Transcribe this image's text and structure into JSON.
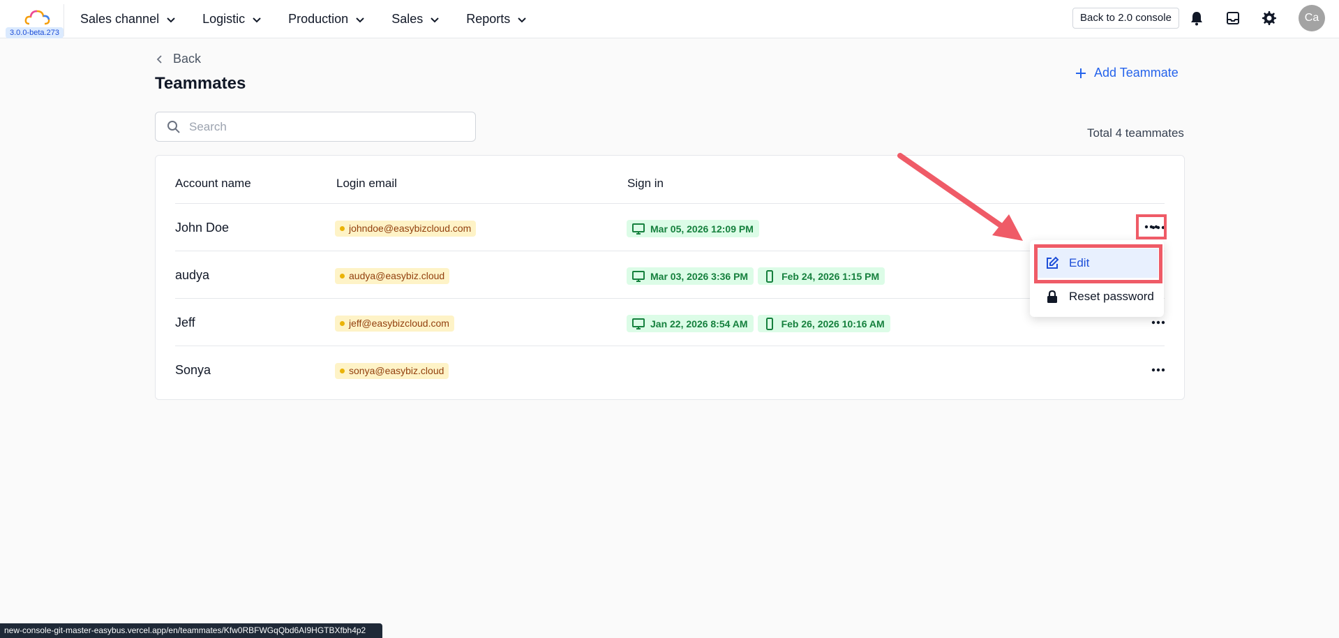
{
  "app": {
    "version": "3.0.0-beta.273"
  },
  "nav": {
    "items": [
      {
        "label": "Sales channel"
      },
      {
        "label": "Logistic"
      },
      {
        "label": "Production"
      },
      {
        "label": "Sales"
      },
      {
        "label": "Reports"
      }
    ],
    "back_console_label": "Back to 2.0 console",
    "avatar_initials": "Ca"
  },
  "page": {
    "back_label": "Back",
    "title": "Teammates",
    "add_label": "Add Teammate",
    "search_placeholder": "Search",
    "search_value": "",
    "total_label": "Total 4 teammates"
  },
  "table": {
    "headers": {
      "account_name": "Account name",
      "login_email": "Login email",
      "sign_in": "Sign in"
    },
    "rows": [
      {
        "name": "John Doe",
        "email": "johndoe@easybizcloud.com",
        "signins": [
          {
            "device": "desktop-icon",
            "time": "Mar 05, 2026 12:09 PM"
          }
        ]
      },
      {
        "name": "audya",
        "email": "audya@easybiz.cloud",
        "signins": [
          {
            "device": "desktop-icon",
            "time": "Mar 03, 2026 3:36 PM"
          },
          {
            "device": "mobile-icon",
            "time": "Feb 24, 2026 1:15 PM"
          }
        ]
      },
      {
        "name": "Jeff",
        "email": "jeff@easybizcloud.com",
        "signins": [
          {
            "device": "desktop-icon",
            "time": "Jan 22, 2026 8:54 AM"
          },
          {
            "device": "mobile-icon",
            "time": "Feb 26, 2026 10:16 AM"
          }
        ]
      },
      {
        "name": "Sonya",
        "email": "sonya@easybiz.cloud",
        "signins": []
      }
    ]
  },
  "dropdown": {
    "edit_label": "Edit",
    "reset_label": "Reset password"
  },
  "status_bar": {
    "url": "new-console-git-master-easybus.vercel.app/en/teammates/Kfw0RBFWGqQbd6AI9HGTBXfbh4p2"
  },
  "colors": {
    "accent": "#2563eb",
    "annotation": "#ef5b67",
    "email_tag_bg": "#fef3c7",
    "signin_tag_bg": "#dcfce7"
  }
}
